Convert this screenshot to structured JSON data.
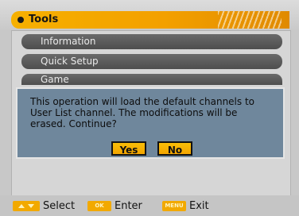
{
  "header": {
    "title": "Tools"
  },
  "menu": {
    "items": [
      {
        "label": "Information"
      },
      {
        "label": "Quick Setup"
      },
      {
        "label": "Game"
      }
    ]
  },
  "dialog": {
    "message": "This operation will load the default channels to User List channel. The modifications will be erased. Continue?",
    "yes_label": "Yes",
    "no_label": "No"
  },
  "footer": {
    "hints": [
      {
        "key_icon": "arrow-keys-icon",
        "label": "Select"
      },
      {
        "key_icon": "ok-key-icon",
        "key_text": "OK",
        "label": "Enter"
      },
      {
        "key_icon": "menu-key-icon",
        "key_text": "MENU",
        "label": "Exit"
      }
    ]
  },
  "colors": {
    "accent": "#f3a500",
    "menu_item_bg": "#5a5a5a",
    "dialog_bg": "#6f879c",
    "panel_bg": "#d6d6d6"
  }
}
